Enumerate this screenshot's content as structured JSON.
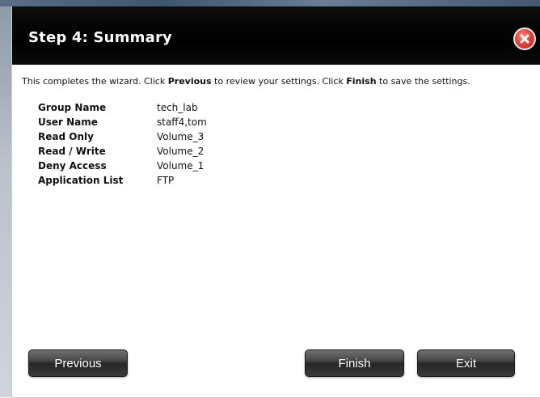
{
  "dialog": {
    "title": "Step 4: Summary",
    "close_icon": "close-icon",
    "intro": {
      "part1": "This completes the wizard. Click ",
      "previous_word": "Previous",
      "part2": " to review your settings. Click ",
      "finish_word": "Finish",
      "part3": " to save the settings."
    },
    "summary": [
      {
        "label": "Group Name",
        "value": "tech_lab"
      },
      {
        "label": "User Name",
        "value": "staff4,tom"
      },
      {
        "label": "Read Only",
        "value": "Volume_3"
      },
      {
        "label": "Read / Write",
        "value": "Volume_2"
      },
      {
        "label": "Deny Access",
        "value": "Volume_1"
      },
      {
        "label": "Application List",
        "value": "FTP"
      }
    ],
    "buttons": {
      "previous": "Previous",
      "finish": "Finish",
      "exit": "Exit"
    }
  },
  "colors": {
    "titlebar": "#000000",
    "close_button": "#e0463a",
    "button": "#3a3a3a"
  }
}
